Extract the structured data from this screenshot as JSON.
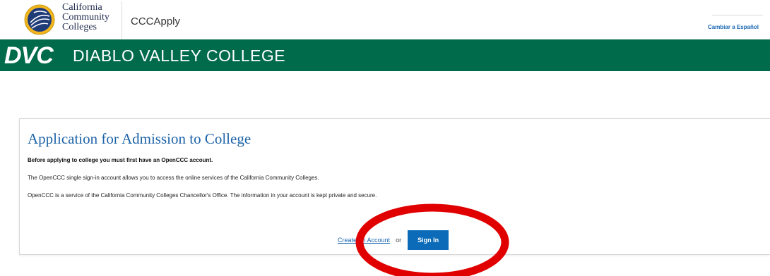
{
  "header": {
    "org_name_lines": [
      "California",
      "Community",
      "Colleges"
    ],
    "app_name": "CCCApply",
    "language_link": "Cambiar a Español"
  },
  "college": {
    "abbrev": "DVC",
    "name": "DIABLO VALLEY COLLEGE",
    "band_color": "#006b4a"
  },
  "card": {
    "title": "Application for Admission to College",
    "lead": "Before applying to college you must first have an OpenCCC account.",
    "paragraph1": "The OpenCCC single sign-in account allows you to access the online services of the California Community Colleges.",
    "paragraph2": "OpenCCC is a service of the California Community Colleges Chancellor's Office. The information in your account is kept private and secure."
  },
  "actions": {
    "create_account_label": "Create an Account",
    "or_label": "or",
    "sign_in_label": "Sign In"
  },
  "annotation": {
    "shape": "ellipse",
    "color": "#e00000",
    "target": "sign-in-button"
  }
}
